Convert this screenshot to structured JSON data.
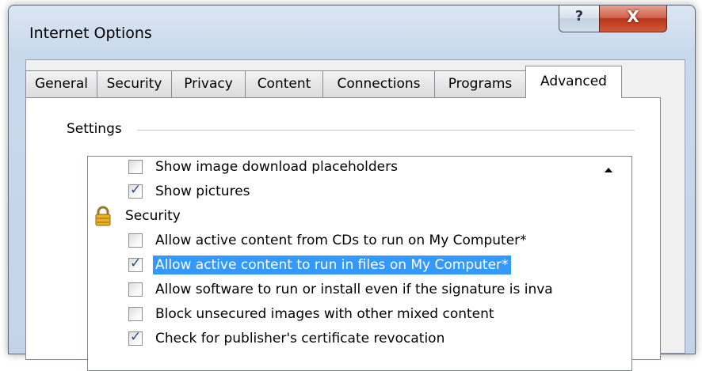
{
  "window": {
    "title": "Internet Options",
    "help_glyph": "?",
    "close_glyph": "X"
  },
  "tabs": [
    {
      "label": "General",
      "active": false
    },
    {
      "label": "Security",
      "active": false
    },
    {
      "label": "Privacy",
      "active": false
    },
    {
      "label": "Content",
      "active": false
    },
    {
      "label": "Connections",
      "active": false
    },
    {
      "label": "Programs",
      "active": false
    },
    {
      "label": "Advanced",
      "active": true
    }
  ],
  "settings": {
    "group_label": "Settings",
    "items": [
      {
        "type": "checkbox",
        "label": "Show image download placeholders",
        "checked": false
      },
      {
        "type": "checkbox",
        "label": "Show pictures",
        "checked": true
      },
      {
        "type": "category",
        "label": "Security",
        "icon": "lock-icon"
      },
      {
        "type": "checkbox",
        "label": "Allow active content from CDs to run on My Computer*",
        "checked": false
      },
      {
        "type": "checkbox",
        "label": "Allow active content to run in files on My Computer*",
        "checked": true,
        "selected": true
      },
      {
        "type": "checkbox",
        "label": "Allow software to run or install even if the signature is inva",
        "checked": false
      },
      {
        "type": "checkbox",
        "label": "Block unsecured images with other mixed content",
        "checked": false
      },
      {
        "type": "checkbox",
        "label": "Check for publisher's certificate revocation",
        "checked": true
      }
    ]
  },
  "colors": {
    "selection": "#3399ff",
    "close_button": "#c4432a",
    "frame": "#c9d9ec"
  }
}
